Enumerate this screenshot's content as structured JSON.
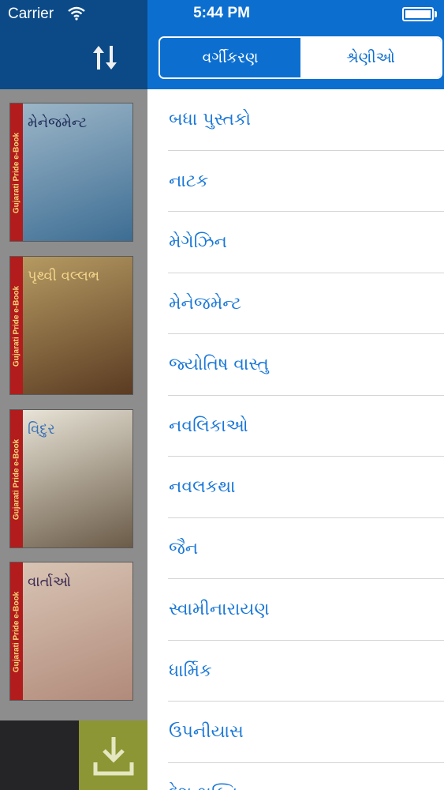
{
  "status_bar": {
    "carrier": "Carrier",
    "time": "5:44 PM",
    "wifi_icon": "wifi-icon",
    "battery_icon": "battery-icon"
  },
  "toolbar": {
    "sort_icon": "sort-arrows-icon",
    "download_icon": "download-icon"
  },
  "segmented_control": {
    "active_index": 0,
    "segments": [
      "વર્ગીકરણ",
      "શ્રેણીઓ"
    ]
  },
  "categories": [
    "બધા પુસ્તકો",
    "નાટક",
    "મેગેઝિન",
    "મેનેજમેન્ટ",
    "જ્યોતિષ વાસ્તુ",
    "નવલિકાઓ",
    "નવલકથા",
    "જૈન",
    "સ્વામીનારાયણ",
    "ધાર્મિક",
    "ઉપનીયાસ",
    "દેશ ભક્તિ"
  ],
  "books": [
    {
      "spine_text": "Gujarati Pride e-Book",
      "title": "મેનેજમેન્ટ",
      "colors": [
        "#9cb6c8",
        "#3d6d93"
      ],
      "title_color": "#1d2a55"
    },
    {
      "spine_text": "Gujarati Pride e-Book",
      "title": "પૃથ્વી વલ્લભ",
      "colors": [
        "#b59a62",
        "#5b3b22"
      ],
      "title_color": "#f2d58a"
    },
    {
      "spine_text": "Gujarati Pride e-Book",
      "title": "વિદુર",
      "colors": [
        "#e7e3d6",
        "#6b5b48"
      ],
      "title_color": "#3a72b8"
    },
    {
      "spine_text": "Gujarati Pride e-Book",
      "title": "વાર્તાઓ",
      "colors": [
        "#d8c4b4",
        "#b18a7a"
      ],
      "title_color": "#3b2b54"
    }
  ]
}
